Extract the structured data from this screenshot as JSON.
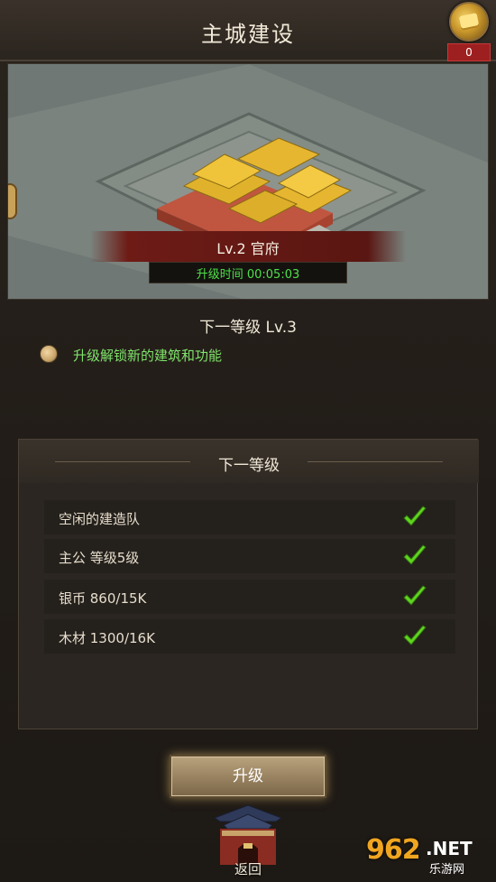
{
  "header": {
    "title": "主城建设",
    "gold_count": "0"
  },
  "building": {
    "name": "Lv.2 官府",
    "timer": "升级时间 00:05:03"
  },
  "next": {
    "title": "下一等级 Lv.3",
    "unlock": "升级解锁新的建筑和功能"
  },
  "requirements": {
    "title": "下一等级",
    "items": [
      {
        "label": "空闲的建造队",
        "met": true
      },
      {
        "label": "主公 等级5级",
        "met": true
      },
      {
        "label": "银币 860/15K",
        "met": true
      },
      {
        "label": "木材 1300/16K",
        "met": true
      }
    ]
  },
  "actions": {
    "upgrade_label": "升级",
    "back_label": "返回"
  },
  "watermark": {
    "number": "962",
    "suffix": ".NET",
    "sub": "乐游网"
  },
  "colors": {
    "accent_green": "#4ee04a",
    "check_green": "#5fd51f",
    "banner_red": "#6e1b16"
  }
}
